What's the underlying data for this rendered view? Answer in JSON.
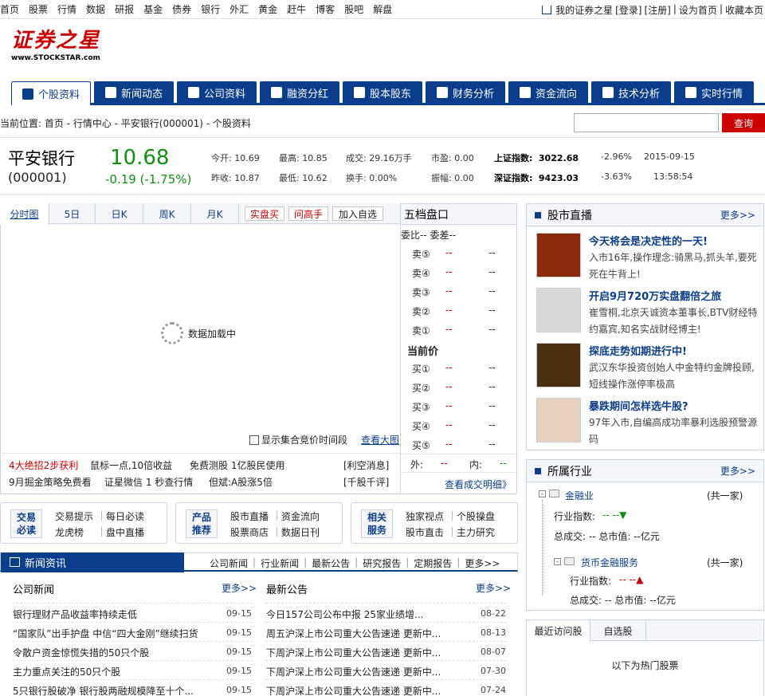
{
  "topnav": {
    "links": [
      "首页",
      "股票",
      "行情",
      "数据",
      "研报",
      "基金",
      "债券",
      "银行",
      "外汇",
      "黄金",
      "赶牛",
      "博客",
      "股吧",
      "解盘"
    ],
    "right": [
      "我的证券之星",
      "[登录]",
      "[注册]",
      "|",
      "设为首页",
      "|",
      "收藏本页"
    ]
  },
  "logo": {
    "cn": "证券之星",
    "en": "www.STOCKSTAR.com"
  },
  "tabs": [
    "个股资料",
    "新闻动态",
    "公司资料",
    "融资分红",
    "股本股东",
    "财务分析",
    "资金流向",
    "技术分析",
    "实时行情"
  ],
  "breadcrumb": "当前位置: 首页 - 行情中心 - 平安银行(000001) - 个股资料",
  "search": {
    "button": "查询",
    "placeholder": ""
  },
  "quote": {
    "name": "平安银行",
    "code": "(000001)",
    "price": "10.68",
    "change": "-0.19 (-1.75%)",
    "fields": [
      [
        "今开: 10.69",
        "最高: 10.85",
        "成交: 29.16万手",
        "市盈: 0.00"
      ],
      [
        "昨收: 10.87",
        "最低: 10.62",
        "换手: 0.00%",
        "振幅: 0.00"
      ]
    ],
    "indices": [
      {
        "name": "上证指数:",
        "value": "3022.68",
        "pct": "-2.96%",
        "time": "2015-09-15"
      },
      {
        "name": "深证指数:",
        "value": "9423.03",
        "pct": "-3.63%",
        "time": "13:58:54"
      }
    ]
  },
  "chart": {
    "tabs": [
      "分时图",
      "5日",
      "日K",
      "周K",
      "月K"
    ],
    "buttons": [
      "实盘买",
      "问高手"
    ],
    "add_button": "加入自选",
    "loading": "数据加载中",
    "checkbox_label": "显示集合竞价时间段",
    "bigchart": "查看大图",
    "ads": [
      [
        "4大绝招2步获利",
        "鼠标一点,10倍收益",
        "免费测股 1亿股民使用",
        "[利空消息]"
      ],
      [
        "9月掘金策略免费看",
        "证星微信 1 秒查行情",
        "但斌:A股涨5倍",
        "[千股千评]"
      ]
    ]
  },
  "orderbook": {
    "title": "五档盘口",
    "ratio": "委比-- 委差--",
    "sells": [
      "卖⑤",
      "卖④",
      "卖③",
      "卖②",
      "卖①"
    ],
    "current": "当前价",
    "buys": [
      "买①",
      "买②",
      "买③",
      "买④",
      "买⑤"
    ],
    "dash": "--",
    "outer": "外:",
    "inner": "内:",
    "detail": "查看成交明细》"
  },
  "live": {
    "title": "股市直播",
    "more": "更多>>",
    "items": [
      {
        "title": "今天将会是决定性的一天!",
        "desc": "入市16年,操作理念:骑黑马,抓头羊,要死死在牛背上!"
      },
      {
        "title": "开启9月720万实盘翻倍之旅",
        "desc": "崔雪桐,北京天诚资本董事长,BTV财经特约嘉宾,知名实战财经博主!"
      },
      {
        "title": "探底走势如期进行中!",
        "desc": "武汉东华投资创始人中金特约金牌投顾,短线操作涨停率极高"
      },
      {
        "title": "暴跌期间怎样选牛股?",
        "desc": "97年入市,自编高成功率暴利选股预警源码"
      }
    ]
  },
  "industry": {
    "title": "所属行业",
    "more": "更多>>",
    "l1": {
      "name": "金融业",
      "count": "(共一家)",
      "index_label": "行业指数:",
      "index_val": "-- --▼",
      "vol": "总成交: -- 总市值: --亿元"
    },
    "l2": {
      "name": "货币金融服务",
      "count": "(共一家)",
      "index_label": "行业指数:",
      "index_val": "-- --▲",
      "vol": "总成交: -- 总市值: --亿元"
    }
  },
  "recent": {
    "tabs": [
      "最近访问股",
      "自选股"
    ],
    "hot": "以下为热门股票"
  },
  "boxes": [
    {
      "badge": [
        "交易",
        "必读"
      ],
      "links": [
        [
          "交易提示",
          "每日必读"
        ],
        [
          "龙虎榜",
          "盘中直播"
        ]
      ]
    },
    {
      "badge": [
        "产品",
        "推荐"
      ],
      "links": [
        [
          "股市直播",
          "资金流向"
        ],
        [
          "股票商店",
          "数据日刊"
        ]
      ]
    },
    {
      "badge": [
        "相关",
        "服务"
      ],
      "links": [
        [
          "独家视点",
          "个股操盘"
        ],
        [
          "股市直击",
          "主力研究"
        ]
      ]
    }
  ],
  "news": {
    "tab": "新闻资讯",
    "links": [
      "公司新闻",
      "|",
      "行业新闻",
      "|",
      "最新公告",
      "|",
      "研究报告",
      "|",
      "定期报告",
      "|",
      "更多>>"
    ],
    "company": {
      "title": "公司新闻",
      "more": "更多>>",
      "rows": [
        [
          "银行理财产品收益率持续走低",
          "09-15"
        ],
        [
          "“国家队”出手护盘 中信“四大金刚”继续扫货",
          "09-15"
        ],
        [
          "令散户资金惊慌失措的50只个股",
          "09-15"
        ],
        [
          "主力重点关注的50只个股",
          "09-15"
        ],
        [
          "5只银行股破净 银行股两融规模降至十个...",
          "09-15"
        ]
      ]
    },
    "announce": {
      "title": "最新公告",
      "more": "更多>>",
      "rows": [
        [
          "今日157公司公布中报 25家业绩增...",
          "08-22"
        ],
        [
          "周五沪深上市公司重大公告速递 更新中...",
          "08-13"
        ],
        [
          "下周沪深上市公司重大公告速递 更新中...",
          "08-07"
        ],
        [
          "下周沪深上市公司重大公告速递 更新中...",
          "07-30"
        ],
        [
          "下周沪深上市公司重大公告速递 更新中...",
          "07-24"
        ]
      ]
    }
  },
  "colors": {
    "brand": "#0a3d8c",
    "down": "#109010",
    "up": "#cc0000"
  }
}
